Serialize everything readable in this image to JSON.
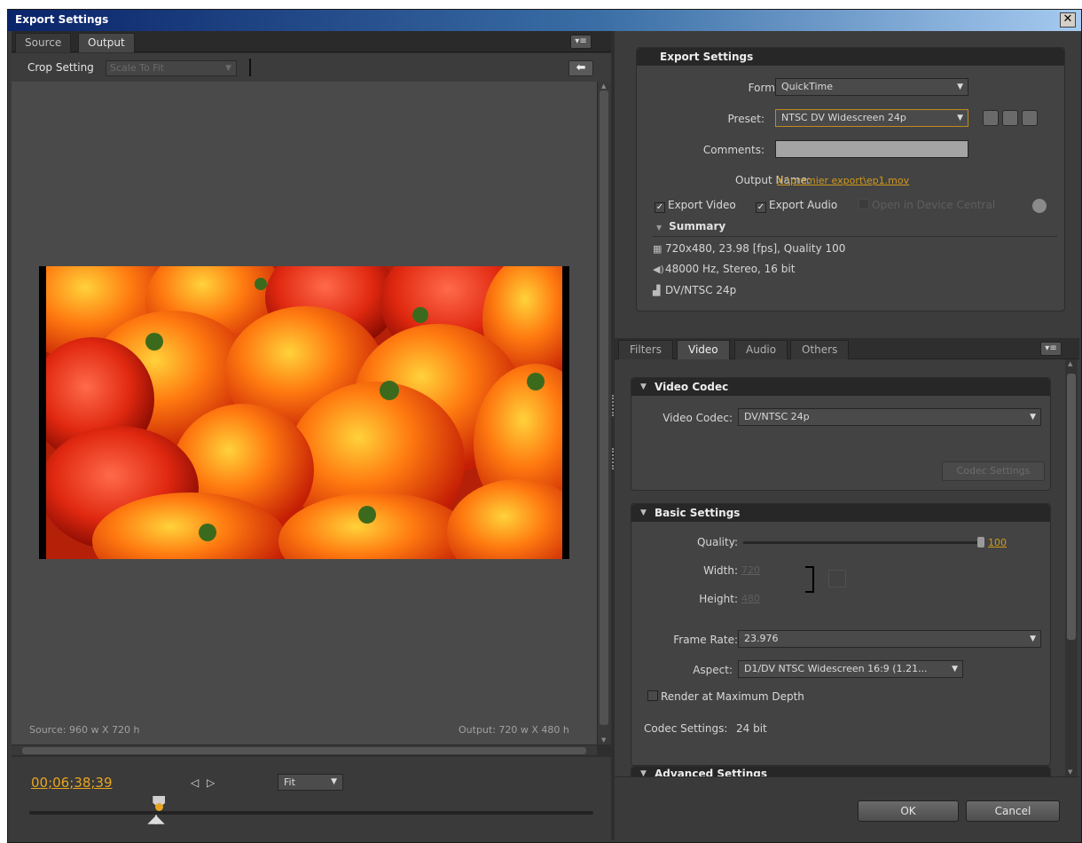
{
  "window": {
    "title": "Export Settings",
    "close_icon": "close-icon"
  },
  "left": {
    "tabs": [
      "Source",
      "Output"
    ],
    "active_tab": "Output",
    "crop": {
      "label": "Crop Setting",
      "value": "Scale To Fit"
    },
    "source_info": "Source: 960 w X 720 h",
    "output_info": "Output: 720 w X 480 h",
    "timecode": "00;06;38;39",
    "mark_in_icon": "◁",
    "mark_out_icon": "▷",
    "zoom": "Fit",
    "playhead_position": 0.23
  },
  "export_settings": {
    "header": "Export Settings",
    "format_label": "Format:",
    "format_value": "QuickTime",
    "preset_label": "Preset:",
    "preset_value": "NTSC DV Widescreen 24p",
    "comments_label": "Comments:",
    "comments_value": "",
    "output_name_label": "Output Name:",
    "output_name_value": "X:\\premier export\\ep1.mov",
    "export_video_label": "Export Video",
    "export_video_checked": true,
    "export_audio_label": "Export Audio",
    "export_audio_checked": true,
    "device_central_label": "Open in Device Central",
    "summary_label": "Summary",
    "summary_video": "720x480, 23.98 [fps], Quality 100",
    "summary_audio": "48000 Hz, Stereo, 16 bit",
    "summary_codec": "DV/NTSC 24p"
  },
  "settings_tabs": [
    "Filters",
    "Video",
    "Audio",
    "Others"
  ],
  "active_settings_tab": "Video",
  "video_codec": {
    "header": "Video Codec",
    "label": "Video Codec:",
    "value": "DV/NTSC 24p",
    "codec_settings_button": "Codec Settings"
  },
  "basic_settings": {
    "header": "Basic Settings",
    "quality_label": "Quality:",
    "quality_value": "100",
    "width_label": "Width:",
    "width_value": "720",
    "height_label": "Height:",
    "height_value": "480",
    "frame_rate_label": "Frame Rate:",
    "frame_rate_value": "23.976",
    "aspect_label": "Aspect:",
    "aspect_value": "D1/DV NTSC Widescreen 16:9 (1.21...",
    "render_max_depth_label": "Render at Maximum Depth",
    "codec_settings_label": "Codec Settings:",
    "codec_settings_value": "24 bit"
  },
  "advanced_settings": {
    "header": "Advanced Settings"
  },
  "footer": {
    "ok": "OK",
    "cancel": "Cancel"
  },
  "colors": {
    "accent": "#d19a1c",
    "panel": "#3c3c3c",
    "header": "#272727"
  }
}
